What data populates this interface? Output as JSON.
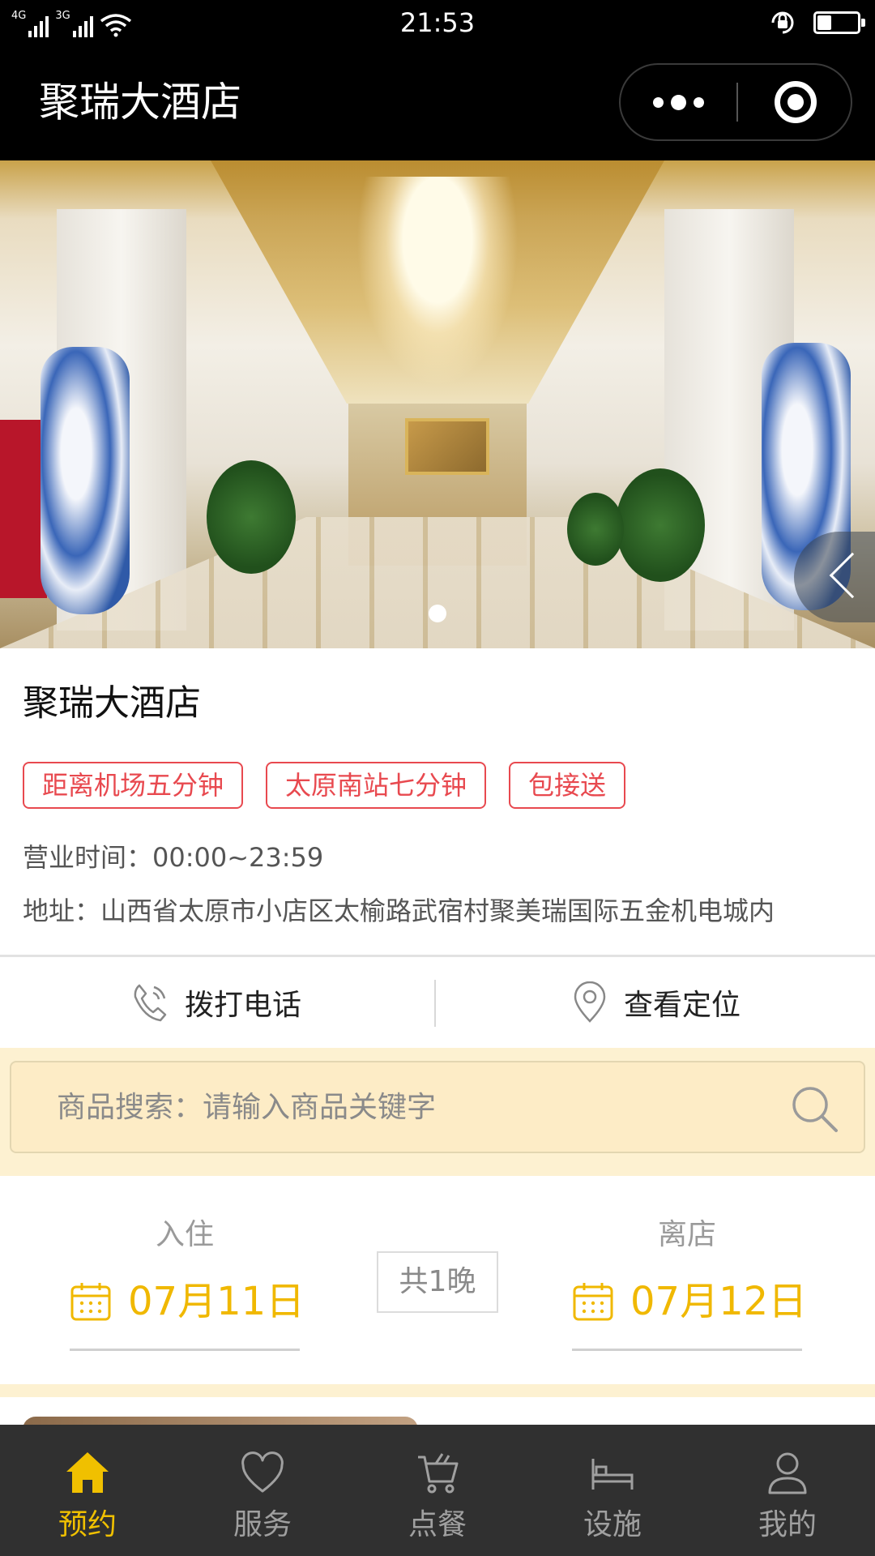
{
  "status_bar": {
    "net1": "4G",
    "net2": "3G",
    "time": "21:53",
    "battery_level": 0.35
  },
  "nav": {
    "title": "聚瑞大酒店"
  },
  "banner": {
    "slide_count": 1,
    "active_slide": 1
  },
  "hotel": {
    "name": "聚瑞大酒店",
    "tags": [
      "距离机场五分钟",
      "太原南站七分钟",
      "包接送"
    ],
    "hours": "营业时间：00:00~23:59",
    "address": "地址：山西省太原市小店区太榆路武宿村聚美瑞国际五金机电城内"
  },
  "actions": {
    "call_label": "拨打电话",
    "location_label": "查看定位"
  },
  "search": {
    "placeholder": "商品搜索：请输入商品关键字"
  },
  "booking": {
    "checkin_label": "入住",
    "checkin_date": "07月11日",
    "checkout_label": "离店",
    "checkout_date": "07月12日",
    "nights": "共1晚"
  },
  "tabs": [
    {
      "label": "预约",
      "icon": "home-icon",
      "active": true
    },
    {
      "label": "服务",
      "icon": "heart-icon",
      "active": false
    },
    {
      "label": "点餐",
      "icon": "cart-icon",
      "active": false
    },
    {
      "label": "设施",
      "icon": "bed-icon",
      "active": false
    },
    {
      "label": "我的",
      "icon": "user-icon",
      "active": false
    }
  ],
  "colors": {
    "accent": "#f0c000",
    "tag_red": "#e8494f",
    "search_bg": "#fdecc6",
    "tab_bar_bg": "#303030"
  }
}
